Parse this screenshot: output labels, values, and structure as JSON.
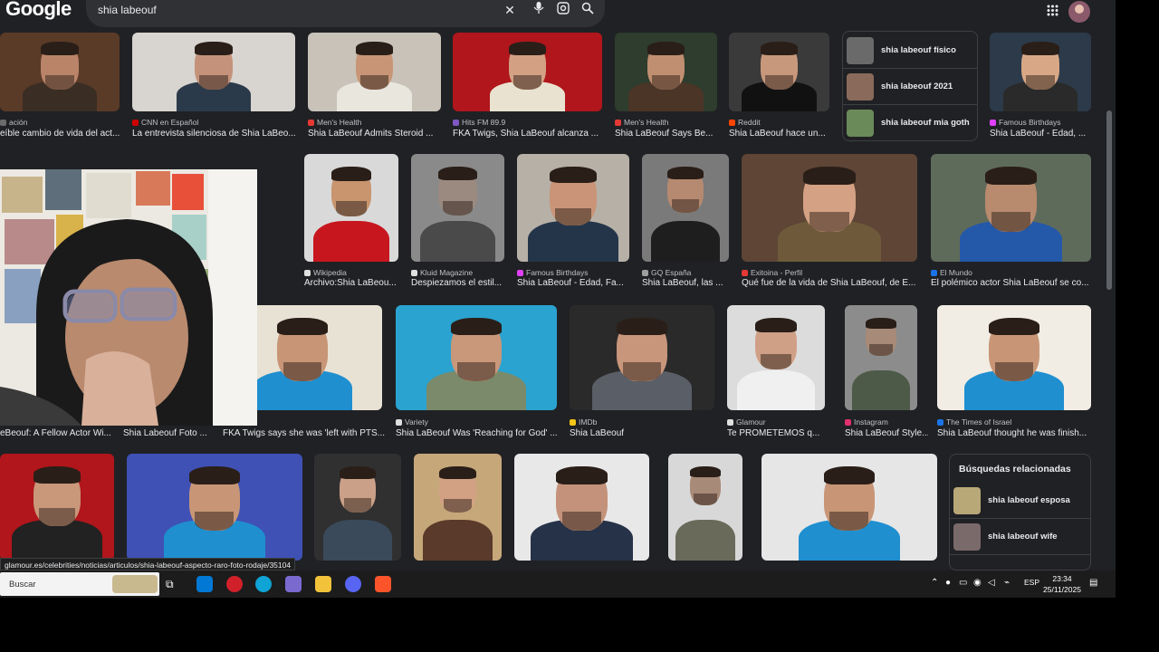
{
  "search": {
    "logo": "Google",
    "query": "shia labeouf"
  },
  "header_icons": [
    "close-icon",
    "microphone-icon",
    "lens-icon",
    "search-icon",
    "apps-grid-icon",
    "account-avatar"
  ],
  "rows": {
    "row1": [
      {
        "src": "ación",
        "title": "eíble cambio de vida del act...",
        "fav": "#6b6b6b",
        "bg": "#5a3b28",
        "skin": "#b98468",
        "shirt": "#3a2d24"
      },
      {
        "src": "CNN en Español",
        "title": "La entrevista silenciosa de Shia LaBeo...",
        "fav": "#cc0000",
        "bg": "#d8d4cf",
        "skin": "#c4927a",
        "shirt": "#2b3a4a"
      },
      {
        "src": "Men's Health",
        "title": "Shia LaBeouf Admits Steroid ...",
        "fav": "#e53935",
        "bg": "#c8c2b8",
        "skin": "#c89676",
        "shirt": "#e9e6de"
      },
      {
        "src": "Hits FM 89.9",
        "title": "FKA Twigs, Shia LaBeouf alcanza ...",
        "fav": "#7e57c2",
        "bg": "#b0161b",
        "skin": "#d3a083",
        "shirt": "#e9e2d0"
      },
      {
        "src": "Men's Health",
        "title": "Shia LaBeouf Says Be...",
        "fav": "#e53935",
        "bg": "#2e3d2e",
        "skin": "#c08e70",
        "shirt": "#4a3526"
      },
      {
        "src": "Reddit",
        "title": "Shia LaBeouf hace un...",
        "fav": "#ff4500",
        "bg": "#3a3a3a",
        "skin": "#c8987c",
        "shirt": "#111111"
      },
      {
        "src": "Famous Birthdays",
        "title": "Shia LaBeouf - Edad, ...",
        "fav": "#e040fb",
        "bg": "#2c3a4a",
        "skin": "#d8a886",
        "shirt": "#2a2a2a"
      }
    ],
    "row2": [
      {
        "src": "Wikipedia",
        "title": "Archivo:Shia LaBeou...",
        "fav": "#e0e0e0",
        "bg": "#d9d9d9",
        "skin": "#c8956f",
        "shirt": "#c7161e"
      },
      {
        "src": "Kluid Magazine",
        "title": "Despiezamos el estil...",
        "fav": "#e0e0e0",
        "bg": "#8a8a8a",
        "skin": "#9a8a80",
        "shirt": "#4a4a4a"
      },
      {
        "src": "Famous Birthdays",
        "title": "Shia LaBeouf - Edad, Fa...",
        "fav": "#e040fb",
        "bg": "#b6b0a6",
        "skin": "#c99477",
        "shirt": "#24354a"
      },
      {
        "src": "GQ España",
        "title": "Shia LaBeouf, las ...",
        "fav": "#9e9e9e",
        "bg": "#7a7a7a",
        "skin": "#b58a70",
        "shirt": "#1e1e1e"
      },
      {
        "src": "Exitoina - Perfil",
        "title": "Qué fue de la vida de Shia LaBeouf, de E...",
        "fav": "#e53935",
        "bg": "#5e4536",
        "skin": "#d4a184",
        "shirt": "#6e5a3a"
      },
      {
        "src": "El Mundo",
        "title": "El polémico actor Shia LaBeouf se co...",
        "fav": "#1a73e8",
        "bg": "#5f6b5a",
        "skin": "#b88a6e",
        "shirt": "#2458a8"
      }
    ],
    "row3": [
      {
        "src": "",
        "title": "eBeouf: A Fellow Actor Wi...",
        "fav": "#9e9e9e",
        "bg": "#3a3a3a",
        "skin": "#c49275",
        "shirt": "#333333"
      },
      {
        "src": "",
        "title": "Shia Labeouf Foto ...",
        "fav": "#9e9e9e",
        "bg": "#e0ddd5",
        "skin": "#c9977a",
        "shirt": "#1f8fd0"
      },
      {
        "src": "",
        "title": "FKA Twigs says she was 'left with PTS...",
        "fav": "#9e9e9e",
        "bg": "#e8e2d5",
        "skin": "#c89676",
        "shirt": "#1f8fd0"
      },
      {
        "src": "Variety",
        "title": "Shia LaBeouf Was 'Reaching for God' ...",
        "fav": "#e0e0e0",
        "bg": "#2aa3d0",
        "skin": "#c9977a",
        "shirt": "#7a8a6a"
      },
      {
        "src": "IMDb",
        "title": "Shia LaBeouf",
        "fav": "#f5c518",
        "bg": "#2a2a2a",
        "skin": "#c8967a",
        "shirt": "#5a5e66"
      },
      {
        "src": "Glamour",
        "title": "Te PROMETEMOS q...",
        "fav": "#e0e0e0",
        "bg": "#dcdcdc",
        "skin": "#d0a086",
        "shirt": "#f0f0f0"
      },
      {
        "src": "Instagram",
        "title": "Shia LaBeouf Style...",
        "fav": "#e1306c",
        "bg": "#8c8c8c",
        "skin": "#a88a78",
        "shirt": "#4e5a48"
      },
      {
        "src": "The Times of Israel",
        "title": "Shia LaBeouf thought he was finish...",
        "fav": "#1a73e8",
        "bg": "#f1ede4",
        "skin": "#c89676",
        "shirt": "#1f8fd0"
      }
    ],
    "row4": [
      {
        "bg": "#b0161b",
        "skin": "#c9977a",
        "shirt": "#222222"
      },
      {
        "bg": "#3f51b5",
        "skin": "#c89676",
        "shirt": "#1f8fd0"
      },
      {
        "bg": "#303030",
        "skin": "#caa088",
        "shirt": "#3a4a5a"
      },
      {
        "bg": "#c6a77a",
        "skin": "#d2a184",
        "shirt": "#5a3a2a"
      },
      {
        "bg": "#e8e8e8",
        "skin": "#c4927a",
        "shirt": "#263248"
      },
      {
        "bg": "#d8d8d8",
        "skin": "#a88a78",
        "shirt": "#6a6a5a"
      },
      {
        "bg": "#e6e6e6",
        "skin": "#c89676",
        "shirt": "#1f8fd0"
      }
    ]
  },
  "related_top": [
    {
      "label": "shia labeouf físico",
      "thumb": "#6a6a6a"
    },
    {
      "label": "shia labeouf 2021",
      "thumb": "#8a6a5a"
    },
    {
      "label": "shia labeouf mia goth",
      "thumb": "#6a8a5a"
    }
  ],
  "related_bottom": {
    "heading": "Búsquedas relacionadas",
    "items": [
      {
        "label": "shia labeouf esposa",
        "thumb": "#b8a878"
      },
      {
        "label": "shia labeouf wife",
        "thumb": "#7a6a6a"
      }
    ]
  },
  "status_url": "glamour.es/celebrities/noticias/articulos/shia-labeouf-aspecto-raro-foto-rodaje/35104",
  "taskbar": {
    "search_placeholder": "Buscar",
    "language": "ESP",
    "time": "23:34",
    "date": "25/11/2025"
  }
}
